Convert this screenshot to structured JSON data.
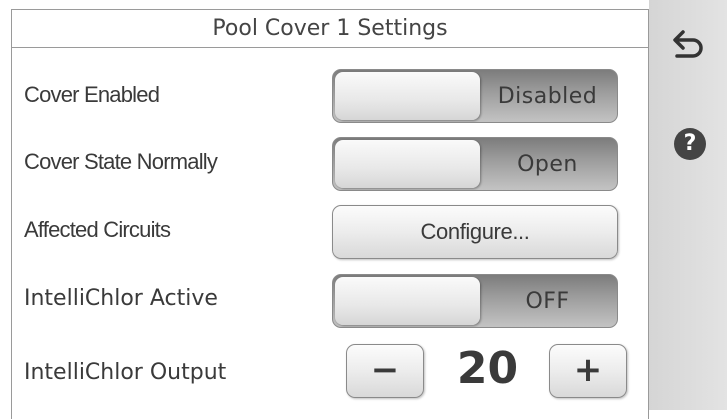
{
  "title": "Pool Cover 1 Settings",
  "rows": {
    "cover_enabled": {
      "label": "Cover Enabled",
      "value": "Disabled"
    },
    "cover_state": {
      "label": "Cover State Normally",
      "value": "Open"
    },
    "affected_circuits": {
      "label": "Affected Circuits",
      "button": "Configure..."
    },
    "intellichlor_active": {
      "label": "IntelliChlor Active",
      "value": "OFF"
    },
    "intellichlor_output": {
      "label": "IntelliChlor Output",
      "value": "20",
      "minus": "−",
      "plus": "+"
    }
  },
  "sidebar": {
    "back_icon": "back-arrow-icon",
    "help_icon": "help-icon",
    "help_glyph": "?"
  }
}
